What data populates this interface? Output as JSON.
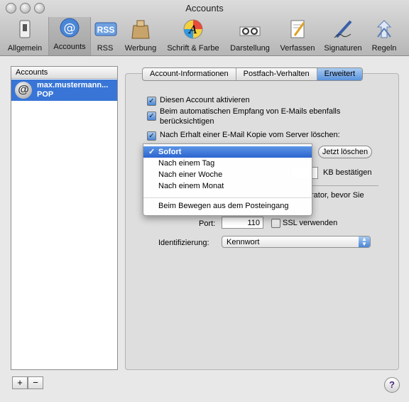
{
  "window": {
    "title": "Accounts"
  },
  "toolbar": {
    "items": [
      {
        "label": "Allgemein",
        "icon": "switch-icon"
      },
      {
        "label": "Accounts",
        "icon": "at-icon"
      },
      {
        "label": "RSS",
        "icon": "rss-icon"
      },
      {
        "label": "Werbung",
        "icon": "junk-bag-icon"
      },
      {
        "label": "Schrift & Farbe",
        "icon": "font-color-icon"
      },
      {
        "label": "Darstellung",
        "icon": "glasses-icon"
      },
      {
        "label": "Verfassen",
        "icon": "compose-icon"
      },
      {
        "label": "Signaturen",
        "icon": "signature-pen-icon"
      },
      {
        "label": "Regeln",
        "icon": "rules-icon"
      }
    ],
    "selected": "Accounts"
  },
  "sidebar": {
    "header": "Accounts",
    "accounts": [
      {
        "name": "max.mustermann...",
        "type": "POP"
      }
    ],
    "add_label": "+",
    "remove_label": "−"
  },
  "tabs": {
    "items": [
      "Account-Informationen",
      "Postfach-Verhalten",
      "Erweitert"
    ],
    "active": "Erweitert"
  },
  "options": {
    "enable_account": {
      "label": "Diesen Account aktivieren",
      "checked": true
    },
    "auto_fetch": {
      "label_line1": "Beim automatischen Empfang von E-Mails ebenfalls",
      "label_line2": "berücksichtigen",
      "checked": true
    },
    "delete_copy": {
      "label": "Nach Erhalt einer E-Mail Kopie vom Server löschen:",
      "checked": true
    },
    "delete_now_button": "Jetzt löschen",
    "kb_label": "KB bestätigen",
    "admin_text": "rator, bevor Sie",
    "port_label": "Port:",
    "port_value": "110",
    "ssl_label": "SSL verwenden",
    "ssl_checked": false,
    "auth_label": "Identifizierung:",
    "auth_value": "Kennwort"
  },
  "delete_menu": {
    "items": [
      "Sofort",
      "Nach einem Tag",
      "Nach einer Woche",
      "Nach einem Monat"
    ],
    "separator_item": "Beim Bewegen aus dem Posteingang",
    "selected": "Sofort",
    "checkmark": "✓"
  },
  "help": {
    "label": "?"
  },
  "colors": {
    "selection": "#3875d7",
    "accent": "#5a93dc"
  }
}
